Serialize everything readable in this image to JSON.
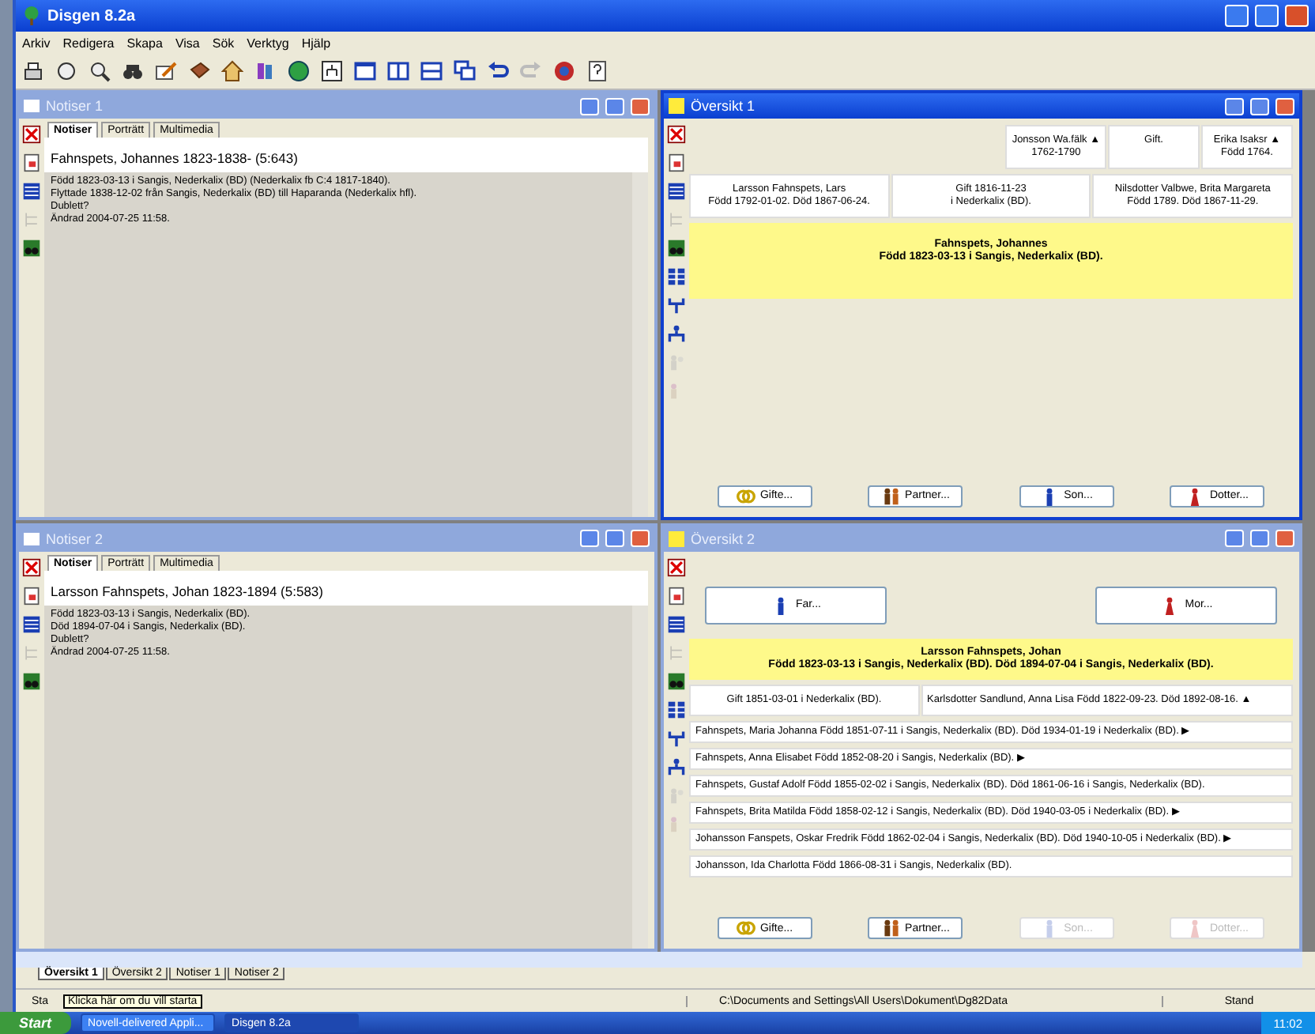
{
  "window": {
    "title": "Disgen 8.2a"
  },
  "menu": [
    "Arkiv",
    "Redigera",
    "Skapa",
    "Visa",
    "Sök",
    "Verktyg",
    "Hjälp"
  ],
  "panes": [
    {
      "kind": "notes",
      "title": "Notiser 1",
      "active": false,
      "tabs": [
        {
          "label": "Notiser",
          "selected": true
        },
        {
          "label": "Porträtt",
          "selected": false
        },
        {
          "label": "Multimedia",
          "selected": false
        }
      ],
      "heading": "Fahnspets, Johannes 1823-1838- (5:643)",
      "lines": [
        "Född 1823-03-13 i Sangis, Nederkalix (BD) (Nederkalix fb C:4 1817-1840).",
        "Flyttade 1838-12-02 från Sangis, Nederkalix (BD) till Haparanda (Nederkalix hfl).",
        "Dublett?",
        "Ändrad 2004-07-25 11:58."
      ]
    },
    {
      "kind": "overview",
      "title": "Översikt 1",
      "active": true,
      "ancestor_rows": [
        [
          {
            "lines": [
              "Jonsson Wa.fälk ▲",
              "1762-1790"
            ]
          },
          {
            "lines": [
              "Gift."
            ]
          },
          {
            "lines": [
              "Erika Isaksr ▲",
              "Född 1764."
            ]
          }
        ],
        [
          {
            "lines": [
              "Larsson Fahnspets, Lars",
              "Född 1792-01-02. Död 1867-06-24."
            ]
          },
          {
            "lines": [
              "Gift 1816-11-23",
              "i Nederkalix (BD)."
            ]
          },
          {
            "lines": [
              "Nilsdotter Valbwe, Brita Margareta",
              "Född 1789. Död 1867-11-29."
            ]
          }
        ]
      ],
      "focus": [
        "Fahnspets, Johannes",
        "Född 1823-03-13 i Sangis, Nederkalix (BD)."
      ],
      "buttons": [
        {
          "label": "Gifte...",
          "kind": "rings",
          "disabled": false
        },
        {
          "label": "Partner...",
          "kind": "couple",
          "disabled": false
        },
        {
          "label": "Son...",
          "kind": "son",
          "disabled": false
        },
        {
          "label": "Dotter...",
          "kind": "daughter",
          "disabled": false
        }
      ]
    },
    {
      "kind": "notes",
      "title": "Notiser 2",
      "active": false,
      "tabs": [
        {
          "label": "Notiser",
          "selected": true
        },
        {
          "label": "Porträtt",
          "selected": false
        },
        {
          "label": "Multimedia",
          "selected": false
        }
      ],
      "heading": "Larsson Fahnspets, Johan 1823-1894 (5:583)",
      "lines": [
        "Född 1823-03-13 i Sangis, Nederkalix (BD).",
        "Död 1894-07-04 i Sangis, Nederkalix (BD).",
        "Dublett?",
        "Ändrad 2004-07-25 11:58."
      ]
    },
    {
      "kind": "overview",
      "title": "Översikt 2",
      "active": false,
      "parent_buttons": [
        {
          "label": "Far...",
          "kind": "man",
          "disabled": false
        },
        {
          "label": "Mor...",
          "kind": "woman",
          "disabled": false
        }
      ],
      "focus": [
        "Larsson Fahnspets, Johan",
        "Född 1823-03-13 i Sangis, Nederkalix (BD). Död 1894-07-04 i Sangis, Nederkalix (BD)."
      ],
      "marriage": [
        "Gift 1851-03-01 i Nederkalix (BD).",
        "Karlsdotter Sandlund, Anna Lisa Född 1822-09-23. Död 1892-08-16. ▲"
      ],
      "children": [
        "Fahnspets, Maria Johanna Född 1851-07-11 i Sangis, Nederkalix (BD). Död 1934-01-19 i Nederkalix (BD). ▶",
        "Fahnspets, Anna Elisabet Född 1852-08-20 i Sangis, Nederkalix (BD). ▶",
        "Fahnspets, Gustaf Adolf Född 1855-02-02 i Sangis, Nederkalix (BD). Död 1861-06-16 i Sangis, Nederkalix (BD).",
        "Fahnspets, Brita Matilda Född 1858-02-12 i Sangis, Nederkalix (BD). Död 1940-03-05 i Nederkalix (BD). ▶",
        "Johansson Fanspets, Oskar Fredrik Född 1862-02-04 i Sangis, Nederkalix (BD). Död 1940-10-05 i Nederkalix (BD). ▶",
        "Johansson, Ida Charlotta Född 1866-08-31 i Sangis, Nederkalix (BD)."
      ],
      "buttons": [
        {
          "label": "Gifte...",
          "kind": "rings",
          "disabled": false
        },
        {
          "label": "Partner...",
          "kind": "couple",
          "disabled": false
        },
        {
          "label": "Son...",
          "kind": "son",
          "disabled": true
        },
        {
          "label": "Dotter...",
          "kind": "daughter",
          "disabled": true
        }
      ]
    }
  ],
  "window_tabs": [
    {
      "label": "Översikt 1",
      "selected": true
    },
    {
      "label": "Översikt 2",
      "selected": false
    },
    {
      "label": "Notiser 1",
      "selected": false
    },
    {
      "label": "Notiser 2",
      "selected": false
    }
  ],
  "status_bar": {
    "left": "Sta",
    "tooltip": "Klicka här om du vill starta",
    "path": "C:\\Documents and Settings\\All Users\\Dokument\\Dg82Data",
    "mode": "Stand"
  },
  "taskbar": {
    "start": "Start",
    "tasks": [
      {
        "label": "Novell-delivered Appli...",
        "selected": false
      },
      {
        "label": "Disgen 8.2a",
        "selected": true
      }
    ],
    "clock": "11:02"
  }
}
